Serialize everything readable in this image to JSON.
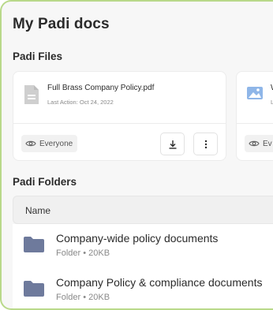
{
  "page": {
    "title": "My Padi docs"
  },
  "files": {
    "section_title": "Padi Files",
    "cards": [
      {
        "name": "Full Brass Company Policy.pdf",
        "meta": "Last Action: Oct 24, 2022",
        "visibility": "Everyone",
        "icon": "document-icon"
      },
      {
        "name": "W",
        "meta": "L",
        "visibility": "Ev",
        "icon": "image-icon"
      }
    ]
  },
  "folders": {
    "section_title": "Padi Folders",
    "column_name": "Name",
    "items": [
      {
        "name": "Company-wide policy documents",
        "meta": "Folder • 20KB"
      },
      {
        "name": "Company Policy & compliance documents",
        "meta": "Folder • 20KB"
      }
    ]
  },
  "colors": {
    "frame_border": "#b9d98a",
    "folder_icon": "#6e7a9c",
    "image_icon": "#8fb6e8"
  }
}
